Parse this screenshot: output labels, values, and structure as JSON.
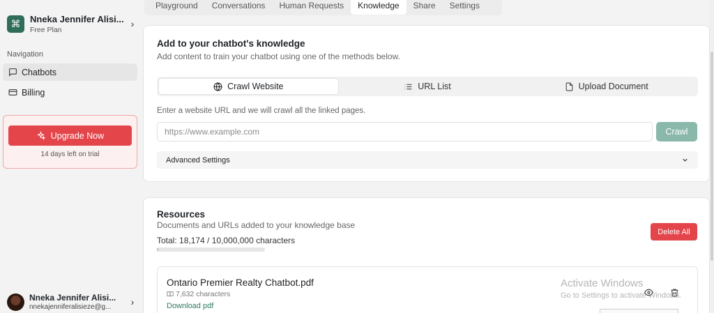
{
  "workspace": {
    "name": "Nneka Jennifer Alisi...",
    "plan": "Free Plan"
  },
  "nav": {
    "label": "Navigation",
    "items": [
      {
        "label": "Chatbots",
        "icon": "message-square-icon",
        "active": true
      },
      {
        "label": "Billing",
        "icon": "credit-card-icon",
        "active": false
      }
    ]
  },
  "upgrade": {
    "button": "Upgrade Now",
    "trial": "14 days left on trial"
  },
  "user": {
    "name": "Nneka Jennifer Alisi...",
    "email": "nnekajenniferalisieze@g..."
  },
  "tabs": [
    "Playground",
    "Conversations",
    "Human Requests",
    "Knowledge",
    "Share",
    "Settings"
  ],
  "active_tab": "Knowledge",
  "knowledge": {
    "title": "Add to your chatbot's knowledge",
    "subtitle": "Add content to train your chatbot using one of the methods below.",
    "methods": [
      {
        "label": "Crawl Website",
        "icon": "globe-icon"
      },
      {
        "label": "URL List",
        "icon": "list-icon"
      },
      {
        "label": "Upload Document",
        "icon": "file-icon"
      }
    ],
    "hint": "Enter a website URL and we will crawl all the linked pages.",
    "url_placeholder": "https://www.example.com",
    "crawl_button": "Crawl",
    "advanced": "Advanced Settings"
  },
  "resources": {
    "title": "Resources",
    "subtitle": "Documents and URLs added to your knowledge base",
    "delete_button": "Delete All",
    "total": "Total: 18,174 / 10,000,000 characters",
    "usage_fraction": 0.0018,
    "items": [
      {
        "name": "Ontario Premier Realty Chatbot.pdf",
        "chars": "7,632 characters",
        "link": "Download pdf"
      }
    ]
  },
  "watermark": {
    "line1": "Activate Windows",
    "line2": "Go to Settings to activate Windows."
  },
  "colors": {
    "brand": "#2f6d5a",
    "danger": "#e4454b",
    "crawl": "#8ab8aa",
    "link": "#2f7a64"
  }
}
